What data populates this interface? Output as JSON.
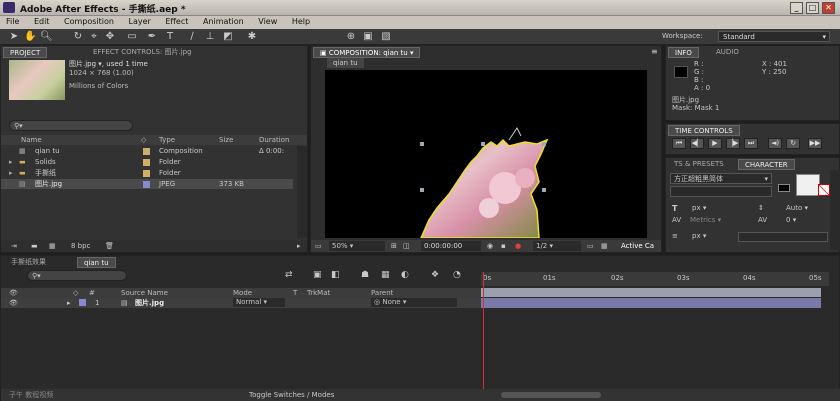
{
  "window": {
    "title": "Adobe After Effects - 手撕纸.aep *",
    "min": "_",
    "max": "□",
    "close": "✕"
  },
  "menu": [
    "File",
    "Edit",
    "Composition",
    "Layer",
    "Effect",
    "Animation",
    "View",
    "Help"
  ],
  "workspace": {
    "label": "Workspace:",
    "value": "Standard"
  },
  "project": {
    "tab1": "PROJECT",
    "tab2": "EFFECT CONTROLS: 图片.jpg",
    "item_name": "图片.jpg",
    "item_used": ", used 1 time",
    "dimensions": "1024 × 768 (1.00)",
    "colors": "Millions of Colors",
    "columns": {
      "name": "Name",
      "type": "Type",
      "size": "Size",
      "duration": "Duration"
    },
    "items": [
      {
        "name": "qian tu",
        "type": "Composition",
        "size": "",
        "duration": "Δ 0:00:",
        "color": "#c8b070"
      },
      {
        "name": "Solids",
        "type": "Folder",
        "size": "",
        "duration": "",
        "color": "#d0b060"
      },
      {
        "name": "手撕纸",
        "type": "Folder",
        "size": "",
        "duration": "",
        "color": "#d0b060"
      },
      {
        "name": "图片.jpg",
        "type": "JPEG",
        "size": "373 KB",
        "duration": "",
        "color": "#8888cc"
      }
    ],
    "bpc": "8 bpc"
  },
  "composition": {
    "tab": "COMPOSITION: qian tu",
    "subtab": "qian tu",
    "zoom": "50%",
    "time": "0:00:00:00",
    "resolution": "1/2",
    "camera": "Active Ca"
  },
  "info": {
    "tab1": "INFO",
    "tab2": "AUDIO",
    "r": "R :",
    "g": "G :",
    "b": "B :",
    "a": "A : 0",
    "x": "X : 401",
    "y": "Y : 250",
    "file": "图片.jpg",
    "mask": "Mask: Mask 1"
  },
  "time_controls": {
    "tab": "TIME CONTROLS"
  },
  "character": {
    "tab1": "TS & PRESETS",
    "tab2": "CHARACTER",
    "font": "方正超粗黑简体",
    "size_unit": "px",
    "leading": "Auto",
    "metrics": "Metrics",
    "tracking": "0",
    "stroke_unit": "px"
  },
  "timeline": {
    "tab1": "手撕纸效果",
    "tab2": "qian tu",
    "columns": {
      "source": "Source Name",
      "mode": "Mode",
      "t": "T",
      "trkmat": "TrkMat",
      "parent": "Parent"
    },
    "layer": {
      "num": "1",
      "name": "图片.jpg",
      "mode": "Normal",
      "parent": "None"
    },
    "ruler": [
      "0s",
      "01s",
      "02s",
      "03s",
      "04s",
      "05s"
    ],
    "toggle": "Toggle Switches / Modes"
  },
  "watermark": "子午 教程视频"
}
